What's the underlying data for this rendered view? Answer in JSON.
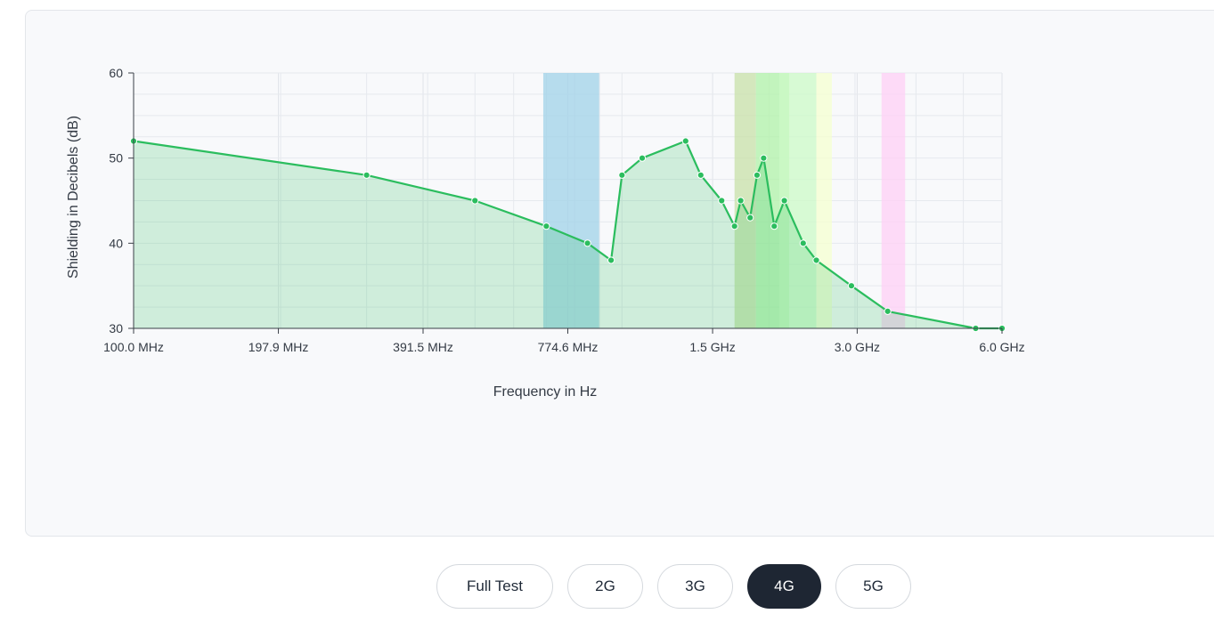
{
  "tabs": {
    "items": [
      {
        "label": "Full Test"
      },
      {
        "label": "2G"
      },
      {
        "label": "3G"
      },
      {
        "label": "4G"
      },
      {
        "label": "5G"
      }
    ],
    "active": "4G"
  },
  "chart_data": {
    "type": "area",
    "title": "",
    "xlabel": "Frequency in Hz",
    "ylabel": "Shielding in Decibels (dB)",
    "x_scale": "log",
    "x_unit": "MHz",
    "xlim": [
      100,
      6000
    ],
    "ylim": [
      30,
      60
    ],
    "grid": true,
    "legend": "none",
    "x_ticks": [
      {
        "value": 100,
        "label": "100.0 MHz"
      },
      {
        "value": 197.9,
        "label": "197.9 MHz"
      },
      {
        "value": 391.5,
        "label": "391.5 MHz"
      },
      {
        "value": 774.6,
        "label": "774.6 MHz"
      },
      {
        "value": 1533,
        "label": "1.5 GHz"
      },
      {
        "value": 3031,
        "label": "3.0 GHz"
      },
      {
        "value": 6000,
        "label": "6.0 GHz"
      }
    ],
    "y_ticks": [
      30,
      40,
      50,
      60
    ],
    "series": [
      {
        "color": "#2bbd5e",
        "x": [
          100,
          300,
          500,
          700,
          850,
          950,
          1000,
          1100,
          1350,
          1450,
          1600,
          1700,
          1750,
          1830,
          1890,
          1950,
          2050,
          2150,
          2350,
          2500,
          2950,
          3500,
          5300,
          6000
        ],
        "y": [
          52,
          48,
          45,
          42,
          40,
          38,
          48,
          50,
          52,
          48,
          45,
          42,
          45,
          43,
          48,
          50,
          42,
          45,
          40,
          38,
          35,
          32,
          30,
          30
        ]
      }
    ],
    "bands": [
      {
        "from": 690,
        "to": 898,
        "color": "#a0d2e8"
      },
      {
        "from": 1700,
        "to": 1880,
        "color": "#c8e0a8"
      },
      {
        "from": 1880,
        "to": 2200,
        "color": "#b0f2a8"
      },
      {
        "from": 2100,
        "to": 2500,
        "color": "#ccf9c7"
      },
      {
        "from": 2500,
        "to": 2690,
        "color": "#f6ffd0"
      },
      {
        "from": 3400,
        "to": 3800,
        "color": "#ffcff6"
      }
    ]
  }
}
